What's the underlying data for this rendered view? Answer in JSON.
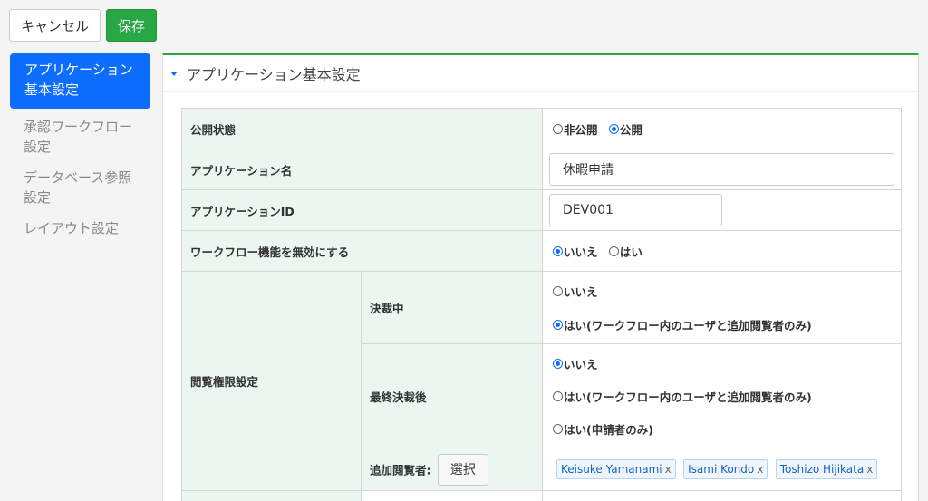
{
  "toolbar": {
    "cancel_label": "キャンセル",
    "save_label": "保存"
  },
  "sidebar": {
    "items": [
      {
        "label_line1": "アプリケーション",
        "label_line2": "基本設定",
        "active": true
      },
      {
        "label_line1": "承認ワークフロー",
        "label_line2": "設定",
        "active": false
      },
      {
        "label_line1": "データベース参照",
        "label_line2": "設定",
        "active": false
      },
      {
        "label_line1": "レイアウト設定",
        "label_line2": "",
        "active": false
      }
    ]
  },
  "panel": {
    "title": "アプリケーション基本設定"
  },
  "form": {
    "publish": {
      "label": "公開状態",
      "options": [
        "非公開",
        "公開"
      ],
      "selected": "公開"
    },
    "app_name": {
      "label": "アプリケーション名",
      "value": "休暇申請"
    },
    "app_id": {
      "label": "アプリケーションID",
      "value": "DEV001"
    },
    "disable_workflow": {
      "label": "ワークフロー機能を無効にする",
      "options": [
        "いいえ",
        "はい"
      ],
      "selected": "いいえ"
    },
    "view_perm": {
      "label": "閲覧権限設定",
      "in_progress": {
        "label": "決裁中",
        "options": [
          "いいえ",
          "はい(ワークフロー内のユーザと追加閲覧者のみ)"
        ],
        "selected": 1
      },
      "final": {
        "label": "最終決裁後",
        "options": [
          "いいえ",
          "はい(ワークフロー内のユーザと追加閲覧者のみ)",
          "はい(申請者のみ)"
        ],
        "selected": 0
      },
      "extra_viewers": {
        "label": "追加閲覧者:",
        "select_label": "選択",
        "remove_glyph": "x",
        "users": [
          "Keisuke Yamanami",
          "Isami Kondo",
          "Toshizo Hijikata"
        ]
      }
    }
  },
  "colors": {
    "accent": "#0d6efd",
    "save": "#28a745",
    "label_bg": "#eaf6ef"
  }
}
